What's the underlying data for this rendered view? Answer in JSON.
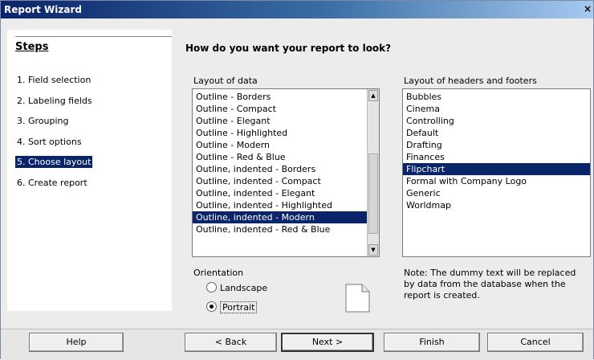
{
  "window": {
    "title": "Report Wizard",
    "close_glyph": "×"
  },
  "steps": {
    "heading": "Steps",
    "items": [
      "1. Field selection",
      "2. Labeling fields",
      "3. Grouping",
      "4. Sort options",
      "5. Choose layout",
      "6. Create report"
    ],
    "active_index": 4
  },
  "main": {
    "question": "How do you want your report to look?",
    "layout_of_data": {
      "label": "Layout of data",
      "items": [
        "Outline - Borders",
        "Outline - Compact",
        "Outline - Elegant",
        "Outline - Highlighted",
        "Outline - Modern",
        "Outline - Red & Blue",
        "Outline, indented - Borders",
        "Outline, indented - Compact",
        "Outline, indented - Elegant",
        "Outline, indented - Highlighted",
        "Outline, indented - Modern",
        "Outline, indented - Red & Blue"
      ],
      "selected": "Outline, indented - Modern"
    },
    "layout_headers_footers": {
      "label": "Layout of headers and footers",
      "items": [
        "Bubbles",
        "Cinema",
        "Controlling",
        "Default",
        "Drafting",
        "Finances",
        "Flipchart",
        "Formal with Company Logo",
        "Generic",
        "Worldmap"
      ],
      "selected": "Flipchart"
    },
    "orientation": {
      "label": "Orientation",
      "landscape": "Landscape",
      "portrait": "Portrait",
      "selected": "Portrait"
    },
    "note": "Note: The dummy text will be replaced by data from the database when the report is created."
  },
  "footer": {
    "help": "Help",
    "back": "< Back",
    "next": "Next >",
    "finish": "Finish",
    "cancel": "Cancel"
  },
  "icons": {
    "portrait_page": "page-portrait-icon",
    "scroll_up": "scroll-up-arrow-icon",
    "scroll_down": "scroll-down-arrow-icon"
  },
  "colors": {
    "selection": "#0a246a",
    "titlebar": "#0a246a"
  }
}
